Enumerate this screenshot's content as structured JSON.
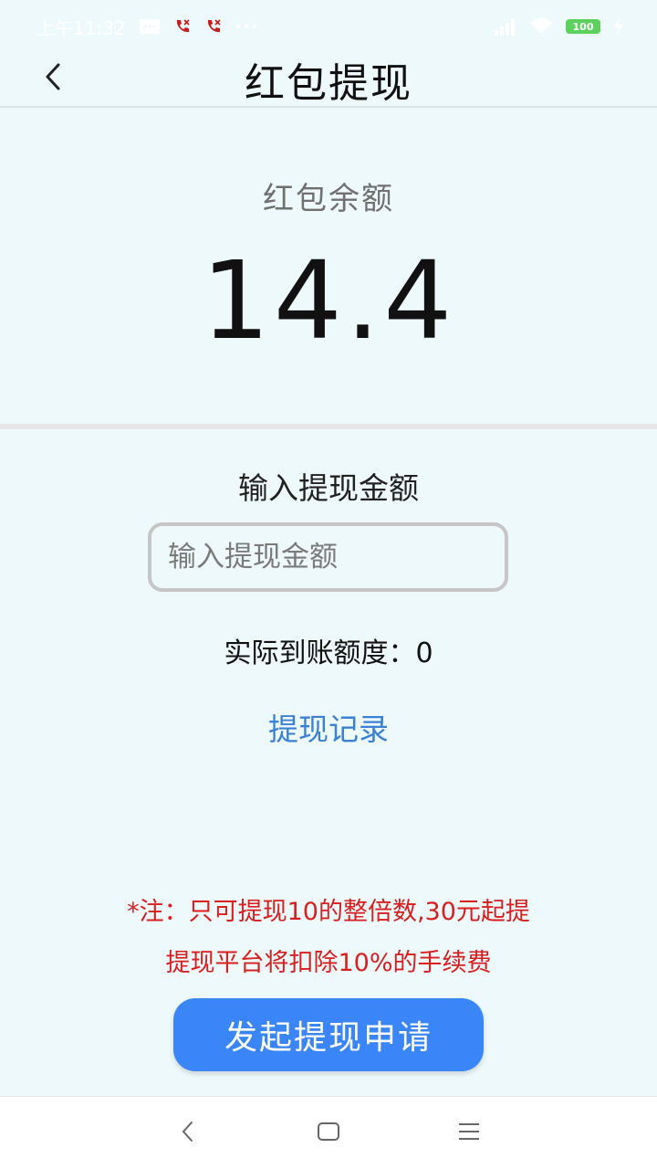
{
  "status_bar": {
    "time": "上午11:32",
    "battery": "100",
    "icons": [
      "message-icon",
      "missed-call-icon",
      "missed-call-icon",
      "more-dots-icon",
      "signal-icon",
      "wifi-icon",
      "battery-icon",
      "charging-icon"
    ]
  },
  "header": {
    "title": "红包提现",
    "back_icon": "back-arrow-icon"
  },
  "balance": {
    "label": "红包余额",
    "value": "14.4"
  },
  "withdraw": {
    "input_label": "输入提现金额",
    "input_placeholder": "输入提现金额",
    "input_value": "",
    "actual_label": "实际到账额度：",
    "actual_value": "0",
    "records_link": "提现记录"
  },
  "notes": {
    "line1": "*注：只可提现10的整倍数,30元起提",
    "line2": "提现平台将扣除10%的手续费"
  },
  "submit_label": "发起提现申请",
  "colors": {
    "background": "#eef9fc",
    "accent": "#3a86f8",
    "link": "#3b82d6",
    "warning": "#d81e1e"
  }
}
